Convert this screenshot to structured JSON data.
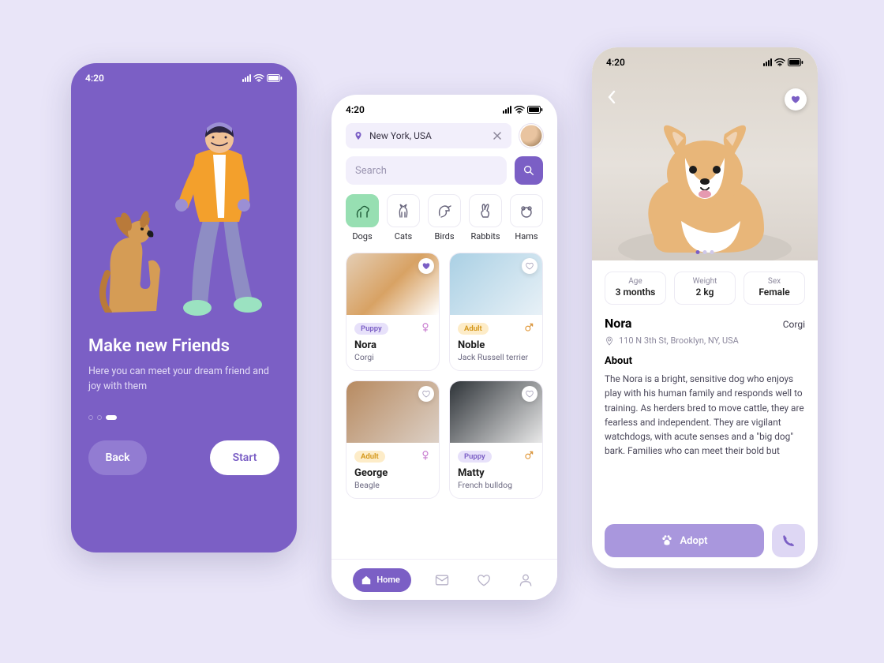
{
  "status_time": "4:20",
  "screen1": {
    "title": "Make new Friends",
    "subtitle": "Here you can meet your dream friend and joy with them",
    "back": "Back",
    "start": "Start"
  },
  "screen2": {
    "location": "New York, USA",
    "search_placeholder": "Search",
    "categories": [
      {
        "label": "Dogs",
        "active": true
      },
      {
        "label": "Cats",
        "active": false
      },
      {
        "label": "Birds",
        "active": false
      },
      {
        "label": "Rabbits",
        "active": false
      },
      {
        "label": "Hams",
        "active": false
      }
    ],
    "pets": [
      {
        "name": "Nora",
        "breed": "Corgi",
        "tag": "Puppy",
        "tag_class": "puppy",
        "sex": "female",
        "favorite": true,
        "img": "img-corgi"
      },
      {
        "name": "Noble",
        "breed": "Jack Russell terrier",
        "tag": "Adult",
        "tag_class": "adult",
        "sex": "male",
        "favorite": false,
        "img": "img-jrt"
      },
      {
        "name": "George",
        "breed": "Beagle",
        "tag": "Adult",
        "tag_class": "adult",
        "sex": "female",
        "favorite": false,
        "img": "img-beagle"
      },
      {
        "name": "Matty",
        "breed": "French bulldog",
        "tag": "Puppy",
        "tag_class": "puppy",
        "sex": "male",
        "favorite": false,
        "img": "img-frenchie"
      }
    ],
    "tab_home": "Home"
  },
  "screen3": {
    "stats": [
      {
        "label": "Age",
        "value": "3 months"
      },
      {
        "label": "Weight",
        "value": "2 kg"
      },
      {
        "label": "Sex",
        "value": "Female"
      }
    ],
    "name": "Nora",
    "breed": "Corgi",
    "address": "110 N 3th St, Brooklyn, NY, USA",
    "about_heading": "About",
    "about": "The Nora is a bright, sensitive dog who enjoys play with his human family and responds well to training. As herders bred to move cattle, they are fearless and independent. They are vigilant watchdogs, with acute senses and a \"big dog\" bark. Families who can meet their bold but",
    "adopt": "Adopt"
  }
}
